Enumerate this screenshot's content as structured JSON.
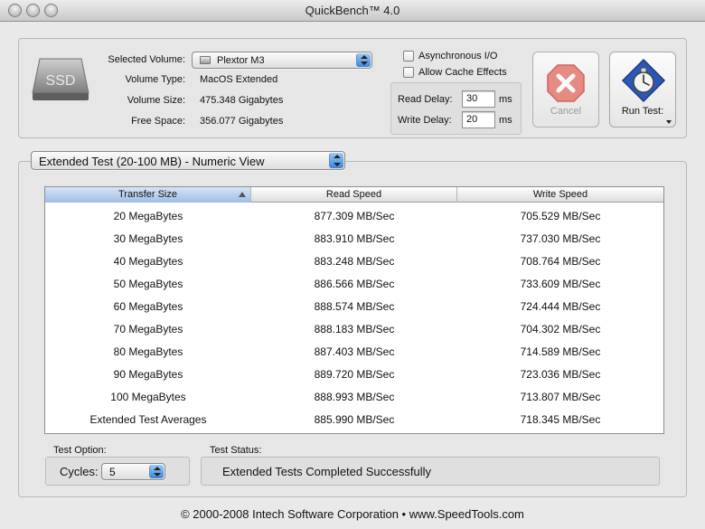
{
  "window": {
    "title": "QuickBench™ 4.0"
  },
  "volume": {
    "selected_label": "Selected Volume:",
    "selected_value": "Plextor M3",
    "type_label": "Volume Type:",
    "type_value": "MacOS Extended",
    "size_label": "Volume Size:",
    "size_value": "475.348 Gigabytes",
    "free_label": "Free Space:",
    "free_value": "356.077 Gigabytes",
    "drive_text": "SSD"
  },
  "options": {
    "async_label": "Asynchronous I/O",
    "async_checked": false,
    "cache_label": "Allow Cache Effects",
    "cache_checked": false,
    "read_delay_label": "Read Delay:",
    "read_delay_value": "30",
    "write_delay_label": "Write Delay:",
    "write_delay_value": "20",
    "unit": "ms"
  },
  "buttons": {
    "cancel_label": "Cancel",
    "run_label": "Run Test:"
  },
  "view_select": {
    "value": "Extended Test (20-100 MB) - Numeric View"
  },
  "table": {
    "headers": [
      "Transfer Size",
      "Read Speed",
      "Write Speed"
    ],
    "rows": [
      [
        "20 MegaBytes",
        "877.309 MB/Sec",
        "705.529 MB/Sec"
      ],
      [
        "30 MegaBytes",
        "883.910 MB/Sec",
        "737.030 MB/Sec"
      ],
      [
        "40 MegaBytes",
        "883.248 MB/Sec",
        "708.764 MB/Sec"
      ],
      [
        "50 MegaBytes",
        "886.566 MB/Sec",
        "733.609 MB/Sec"
      ],
      [
        "60 MegaBytes",
        "888.574 MB/Sec",
        "724.444 MB/Sec"
      ],
      [
        "70 MegaBytes",
        "888.183 MB/Sec",
        "704.302 MB/Sec"
      ],
      [
        "80 MegaBytes",
        "887.403 MB/Sec",
        "714.589 MB/Sec"
      ],
      [
        "90 MegaBytes",
        "889.720 MB/Sec",
        "723.036 MB/Sec"
      ],
      [
        "100 MegaBytes",
        "888.993 MB/Sec",
        "713.807 MB/Sec"
      ],
      [
        "Extended Test Averages",
        "885.990 MB/Sec",
        "718.345 MB/Sec"
      ]
    ]
  },
  "test_option": {
    "title": "Test Option:",
    "cycles_label": "Cycles:",
    "cycles_value": "5"
  },
  "test_status": {
    "title": "Test Status:",
    "text": "Extended Tests Completed Successfully"
  },
  "footer": {
    "text": "© 2000-2008 Intech Software Corporation • www.SpeedTools.com"
  },
  "colors": {
    "accent": "#3b84d8",
    "cancel_red": "#e25b4f",
    "run_blue": "#2b58b8"
  }
}
